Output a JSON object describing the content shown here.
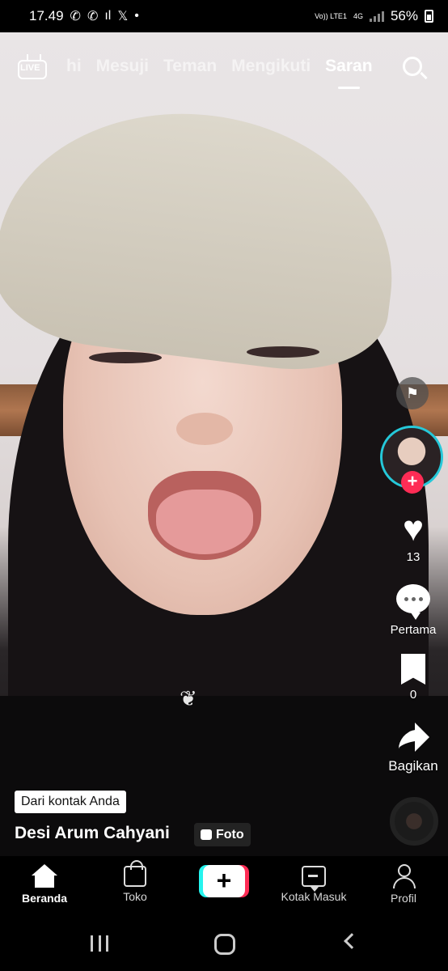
{
  "status_bar": {
    "time": "17.49",
    "left_icons": [
      "whatsapp-icon",
      "whatsapp-icon",
      "signal-icon",
      "x-icon",
      "dot-icon"
    ],
    "volte_label": "Vo)) LTE1",
    "network_label": "4G",
    "battery": "56%"
  },
  "top_nav": {
    "live_label": "LIVE",
    "tabs": [
      {
        "label": "hi"
      },
      {
        "label": "Mesuji"
      },
      {
        "label": "Teman"
      },
      {
        "label": "Mengikuti"
      },
      {
        "label": "Saran"
      }
    ],
    "active_tab": "Saran"
  },
  "actions": {
    "likes": "13",
    "comments": "Pertama",
    "bookmarks": "0",
    "share": "Bagikan"
  },
  "caption": {
    "badge": "Dari kontak Anda",
    "username": "Desi Arum Cahyani",
    "type_tag": "Foto"
  },
  "bottom_nav": {
    "items": [
      {
        "label": "Beranda"
      },
      {
        "label": "Toko"
      },
      {
        "label": "Kotak Masuk"
      },
      {
        "label": "Profil"
      }
    ],
    "active": "Beranda"
  },
  "colors": {
    "accent_red": "#fe2c55",
    "accent_cyan": "#25f4ee"
  }
}
